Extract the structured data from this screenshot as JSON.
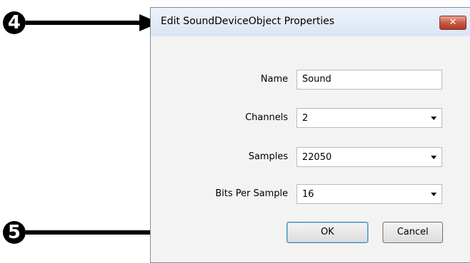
{
  "dialog": {
    "title": "Edit SoundDeviceObject Properties",
    "close_symbol": "✕",
    "fields": {
      "name_label": "Name",
      "name_value": "Sound",
      "channels_label": "Channels",
      "channels_value": "2",
      "samples_label": "Samples",
      "samples_value": "22050",
      "bits_label": "Bits Per Sample",
      "bits_value": "16"
    },
    "ok_label": "OK",
    "cancel_label": "Cancel"
  },
  "callouts": {
    "first": "4",
    "second": "5"
  }
}
